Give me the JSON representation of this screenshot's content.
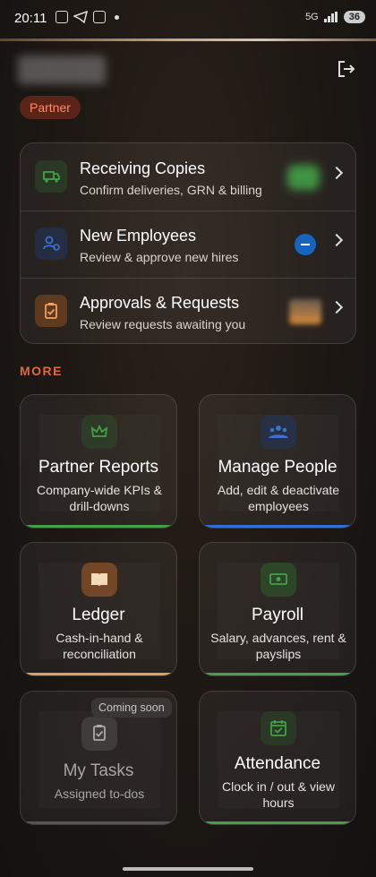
{
  "status_bar": {
    "time": "20:11",
    "network": "5G",
    "battery": "36"
  },
  "header": {
    "role_badge": "Partner"
  },
  "tasks": [
    {
      "title": "Receiving Copies",
      "subtitle": "Confirm deliveries, GRN & billing",
      "icon": "truck-icon",
      "color": "#2e7d32"
    },
    {
      "title": "New Employees",
      "subtitle": "Review & approve new hires",
      "icon": "user-add-icon",
      "color": "#1e3a6a"
    },
    {
      "title": "Approvals & Requests",
      "subtitle": "Review requests awaiting you",
      "icon": "clipboard-check-icon",
      "color": "#8a4e1f"
    }
  ],
  "more_label": "MORE",
  "tiles": [
    {
      "title": "Partner Reports",
      "subtitle": "Company-wide KPIs & drill-downs",
      "icon": "crown-icon",
      "bar_color": "#43a047"
    },
    {
      "title": "Manage People",
      "subtitle": "Add, edit & deactivate employees",
      "icon": "people-icon",
      "bar_color": "#2f6fd6"
    },
    {
      "title": "Ledger",
      "subtitle": "Cash-in-hand & reconciliation",
      "icon": "book-icon",
      "bar_color": "#e0a060"
    },
    {
      "title": "Payroll",
      "subtitle": "Salary, advances, rent & payslips",
      "icon": "cash-icon",
      "bar_color": "#43a047"
    },
    {
      "title": "My Tasks",
      "subtitle": "Assigned to-dos",
      "icon": "clipboard-icon",
      "bar_color": "#555555",
      "badge": "Coming soon"
    },
    {
      "title": "Attendance",
      "subtitle": "Clock in / out & view hours",
      "icon": "calendar-check-icon",
      "bar_color": "#43a047"
    }
  ]
}
